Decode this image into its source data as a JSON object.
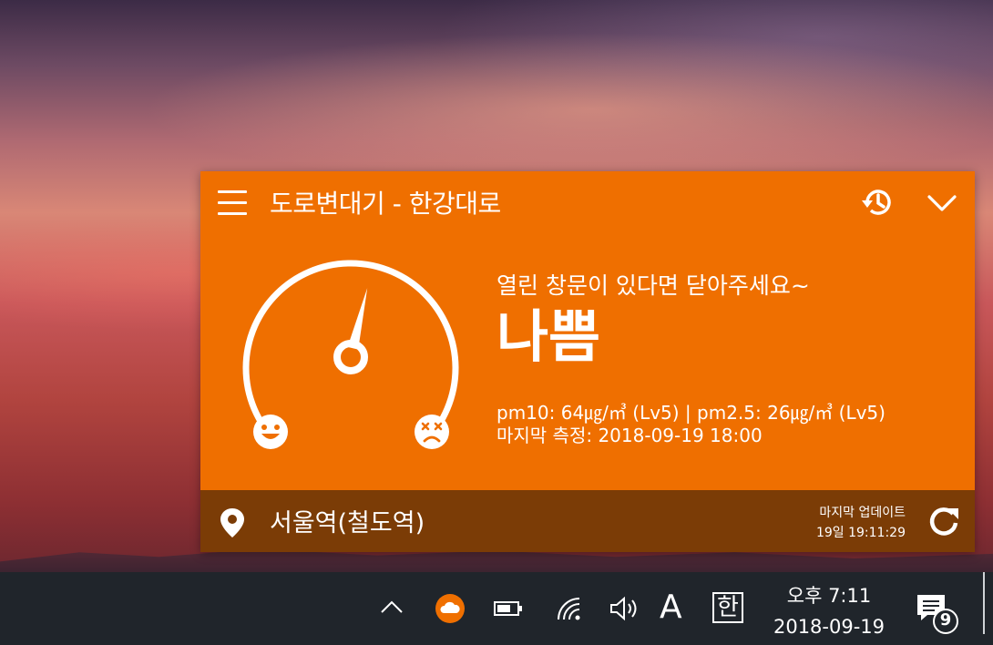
{
  "widget": {
    "title": "도로변대기 - 한강대로",
    "advice": "열린 창문이 있다면 닫아주세요~",
    "status": "나쁨",
    "gauge_level": 0.55,
    "readings": "pm10: 64㎍/㎥ (Lv5)  |  pm2.5: 26㎍/㎥ (Lv5)",
    "last_measured": "마지막 측정: 2018-09-19 18:00",
    "station": "서울역(철도역)",
    "last_update_label": "마지막 업데이트",
    "last_update_time": "19일 19:11:29",
    "colors": {
      "panel": "#ef6f00",
      "footer": "#7b3c06"
    },
    "icons": [
      "menu-icon",
      "history-icon",
      "chevron-down-icon",
      "gauge-icon",
      "smile-face-icon",
      "sad-face-icon",
      "location-pin-icon",
      "refresh-icon"
    ]
  },
  "taskbar": {
    "ime_mode": "A",
    "ime_lang": "한",
    "time": "오후 7:11",
    "date": "2018-09-19",
    "notification_count": "9",
    "icons": [
      "chevron-up-icon",
      "weather-app-icon",
      "battery-icon",
      "wifi-icon",
      "volume-icon",
      "notification-icon"
    ],
    "colors": {
      "background": "#20252b",
      "app_icon": "#ef6f00"
    }
  }
}
